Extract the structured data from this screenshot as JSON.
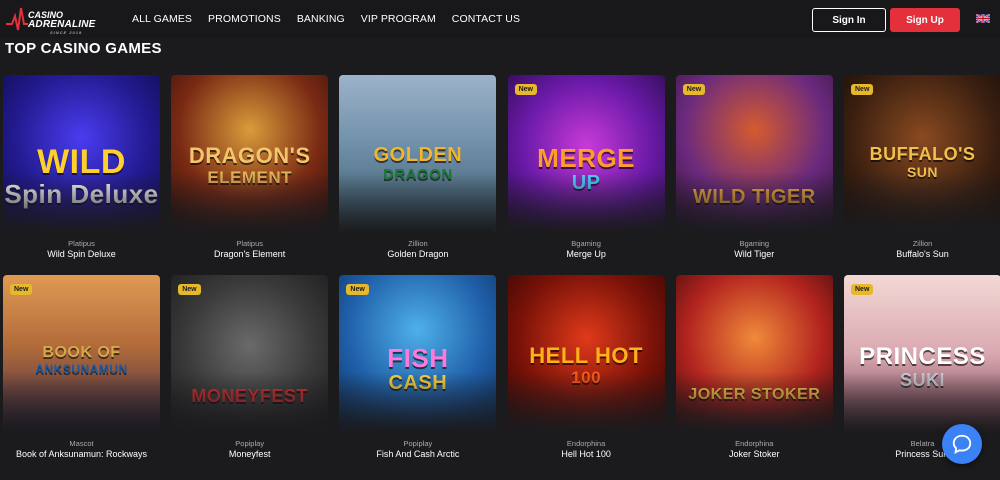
{
  "header": {
    "logo_line1": "CASINO",
    "logo_line2": "ADRENALINE",
    "logo_line3": "SINCE 2019",
    "nav": [
      {
        "label": "ALL GAMES"
      },
      {
        "label": "PROMOTIONS"
      },
      {
        "label": "BANKING"
      },
      {
        "label": "VIP PROGRAM"
      },
      {
        "label": "CONTACT US"
      }
    ],
    "sign_in": "Sign In",
    "sign_up": "Sign Up",
    "accent_color": "#e3303b",
    "language_icon": "uk-flag-icon"
  },
  "section": {
    "title": "TOP CASINO GAMES"
  },
  "games": [
    {
      "provider": "Platipus",
      "name": "Wild Spin Deluxe",
      "art_title": "WILD",
      "art_sub": "Spin Deluxe",
      "new": false,
      "badge": ""
    },
    {
      "provider": "Platipus",
      "name": "Dragon's Element",
      "art_title": "DRAGON'S",
      "art_sub": "ELEMENT",
      "new": false,
      "badge": ""
    },
    {
      "provider": "Zillion",
      "name": "Golden Dragon",
      "art_title": "GOLDEN",
      "art_sub": "DRAGON",
      "new": false,
      "badge": ""
    },
    {
      "provider": "Bgaming",
      "name": "Merge Up",
      "art_title": "MERGE",
      "art_sub": "UP",
      "new": true,
      "badge": "New"
    },
    {
      "provider": "Bgaming",
      "name": "Wild Tiger",
      "art_title": "WILD TIGER",
      "art_sub": "",
      "new": true,
      "badge": "New"
    },
    {
      "provider": "Zillion",
      "name": "Buffalo's Sun",
      "art_title": "BUFFALO'S",
      "art_sub": "SUN",
      "new": true,
      "badge": "New"
    },
    {
      "provider": "Mascot",
      "name": "Book of Anksunamun: Rockways",
      "art_title": "BOOK OF",
      "art_sub": "ANKSUNAMUN",
      "new": true,
      "badge": "New"
    },
    {
      "provider": "Popiplay",
      "name": "Moneyfest",
      "art_title": "MONEYFEST",
      "art_sub": "",
      "new": true,
      "badge": "New"
    },
    {
      "provider": "Popiplay",
      "name": "Fish And Cash Arctic",
      "art_title": "FISH",
      "art_sub": "CASH",
      "new": true,
      "badge": "New"
    },
    {
      "provider": "Endorphina",
      "name": "Hell Hot 100",
      "art_title": "HELL HOT",
      "art_sub": "100",
      "new": false,
      "badge": ""
    },
    {
      "provider": "Endorphina",
      "name": "Joker Stoker",
      "art_title": "JOKER STOKER",
      "art_sub": "",
      "new": false,
      "badge": ""
    },
    {
      "provider": "Belatra",
      "name": "Princess Suki",
      "art_title": "PRINCESS",
      "art_sub": "SUKI",
      "new": true,
      "badge": "New"
    }
  ],
  "chat_icon": "chat-bubble-icon"
}
